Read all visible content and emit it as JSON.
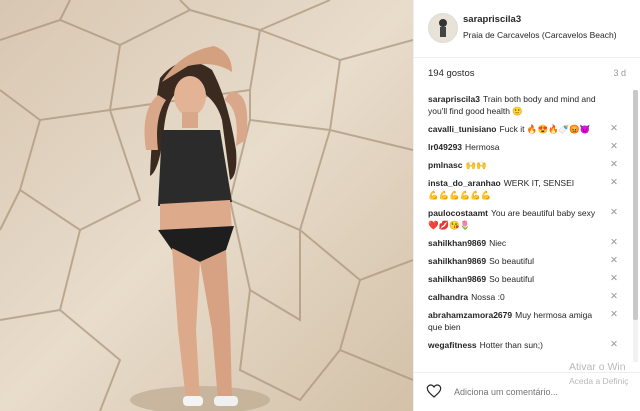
{
  "post": {
    "username": "sarapriscila3",
    "location": "Praia de Carcavelos (Carcavelos Beach)",
    "likes": "194 gostos",
    "time": "3 d"
  },
  "comments": [
    {
      "user": "sarapriscila3",
      "text": "Train both body and mind and you'll find good health 🙂"
    },
    {
      "user": "cavalli_tunisiano",
      "text": "Fuck it 🔥😍🔥🍼😡😈"
    },
    {
      "user": "lr049293",
      "text": "Hermosa"
    },
    {
      "user": "pmlnasc",
      "text": "🙌🙌"
    },
    {
      "user": "insta_do_aranhao",
      "text": "WERK IT, SENSEI"
    },
    {
      "user": "",
      "text": "💪💪💪💪💪💪"
    },
    {
      "user": "paulocostaamt",
      "text": "You are beautiful baby sexy ❤️💋😘🌷"
    },
    {
      "user": "sahilkhan9869",
      "text": "Niec"
    },
    {
      "user": "sahilkhan9869",
      "text": "So beautiful"
    },
    {
      "user": "sahilkhan9869",
      "text": "So beautiful"
    },
    {
      "user": "calhandra",
      "text": "Nossa :0"
    },
    {
      "user": "abrahamzamora2679",
      "text": "Muy hermosa amiga que bien"
    },
    {
      "user": "wegafitness",
      "text": "Hotter than sun;)"
    }
  ],
  "add_comment_placeholder": "Adiciona um comentário...",
  "watermark": {
    "line1": "Ativar o Win",
    "line2": "Aceda a Definiç"
  },
  "close_glyph": "✕",
  "colors": {
    "accent": "#262626",
    "muted": "#999999",
    "border": "#efefef"
  }
}
